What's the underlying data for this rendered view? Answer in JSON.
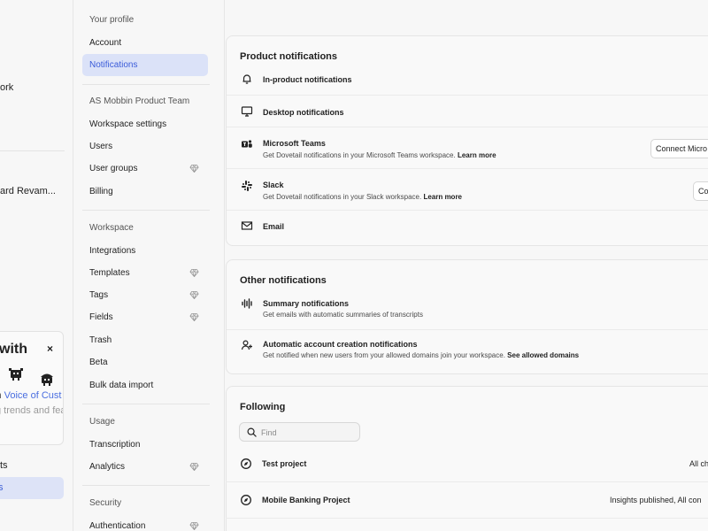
{
  "app_sidebar": {
    "partial_items": [
      "ork",
      "ard Revam...",
      "ts",
      "s"
    ],
    "promo": {
      "title": "with",
      "close": "×",
      "text_prefix": "in ",
      "text_link": "Voice of Cust",
      "text_line2": "g trends and fea"
    }
  },
  "settings_nav": {
    "sections": [
      {
        "title": "Your profile",
        "items": [
          {
            "label": "Account",
            "premium": false,
            "active": false
          },
          {
            "label": "Notifications",
            "premium": false,
            "active": true
          }
        ]
      },
      {
        "title": "AS Mobbin Product Team",
        "items": [
          {
            "label": "Workspace settings",
            "premium": false,
            "active": false
          },
          {
            "label": "Users",
            "premium": false,
            "active": false
          },
          {
            "label": "User groups",
            "premium": true,
            "active": false
          },
          {
            "label": "Billing",
            "premium": false,
            "active": false
          }
        ]
      },
      {
        "title": "Workspace",
        "items": [
          {
            "label": "Integrations",
            "premium": false,
            "active": false
          },
          {
            "label": "Templates",
            "premium": true,
            "active": false
          },
          {
            "label": "Tags",
            "premium": true,
            "active": false
          },
          {
            "label": "Fields",
            "premium": true,
            "active": false
          },
          {
            "label": "Trash",
            "premium": false,
            "active": false
          },
          {
            "label": "Beta",
            "premium": false,
            "active": false
          },
          {
            "label": "Bulk data import",
            "premium": false,
            "active": false
          }
        ]
      },
      {
        "title": "Usage",
        "items": [
          {
            "label": "Transcription",
            "premium": false,
            "active": false
          },
          {
            "label": "Analytics",
            "premium": true,
            "active": false
          }
        ]
      },
      {
        "title": "Security",
        "items": [
          {
            "label": "Authentication",
            "premium": true,
            "active": false
          }
        ]
      }
    ]
  },
  "product_notifications": {
    "title": "Product notifications",
    "rows": [
      {
        "icon": "bell-icon",
        "title": "In-product notifications",
        "desc": "",
        "link": "",
        "button": ""
      },
      {
        "icon": "desktop-icon",
        "title": "Desktop notifications",
        "desc": "",
        "link": "",
        "button": ""
      },
      {
        "icon": "teams-icon",
        "title": "Microsoft Teams",
        "desc": "Get Dovetail notifications in your Microsoft Teams workspace.",
        "link": "Learn more",
        "button": "Connect Micro"
      },
      {
        "icon": "slack-icon",
        "title": "Slack",
        "desc": "Get Dovetail notifications in your Slack workspace.",
        "link": "Learn more",
        "button": "Co"
      },
      {
        "icon": "mail-icon",
        "title": "Email",
        "desc": "",
        "link": "",
        "button": ""
      }
    ]
  },
  "other_notifications": {
    "title": "Other notifications",
    "rows": [
      {
        "icon": "waveform-icon",
        "title": "Summary notifications",
        "desc": "Get emails with automatic summaries of transcripts",
        "link": ""
      },
      {
        "icon": "user-plus-icon",
        "title": "Automatic account creation notifications",
        "desc": "Get notified when new users from your allowed domains join your workspace.",
        "link": "See allowed domains"
      }
    ]
  },
  "following": {
    "title": "Following",
    "search_placeholder": "Find",
    "rows": [
      {
        "icon": "compass-icon",
        "title": "Test project",
        "status": "All ch"
      },
      {
        "icon": "compass-icon",
        "title": "Mobile Banking Project",
        "status": "Insights published, All con"
      }
    ]
  },
  "colors": {
    "accent": "#3a5bd9",
    "active_bg": "#dbe2f8",
    "page_bg": "#f7f7f7",
    "card_bg": "#f9f9f9",
    "border": "#e5e5e5"
  }
}
